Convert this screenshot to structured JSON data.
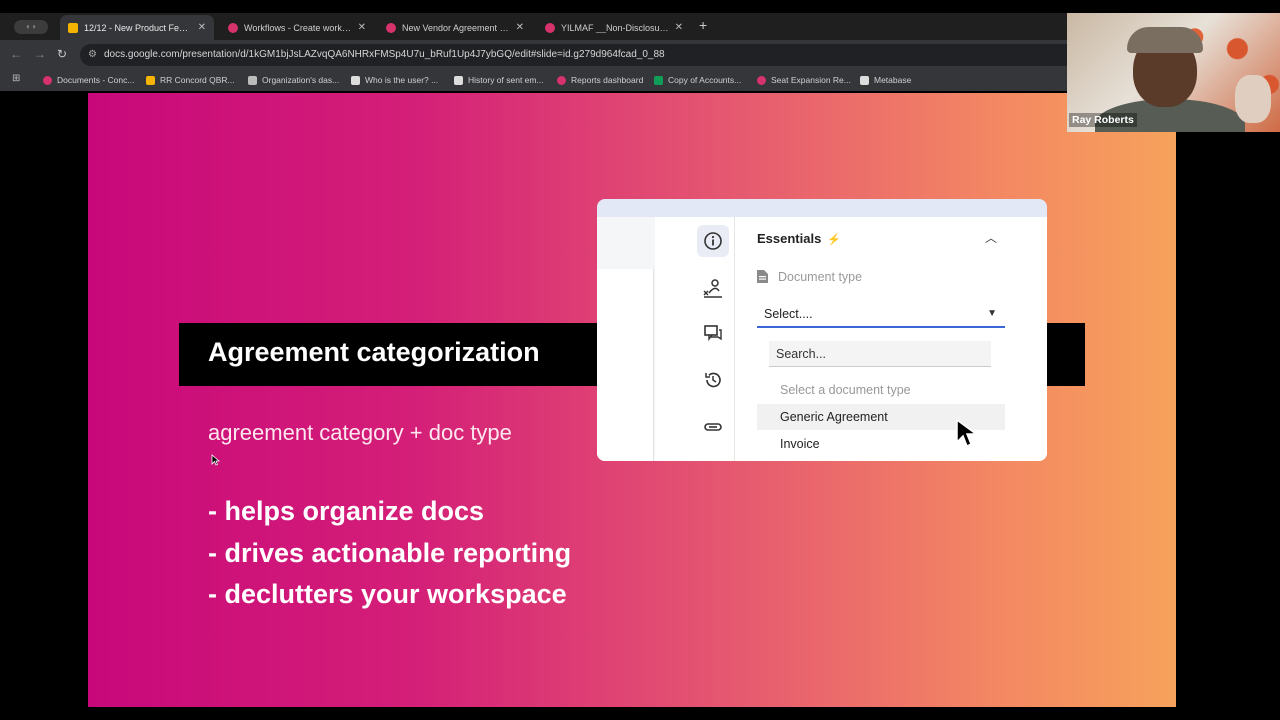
{
  "browser": {
    "tabs": [
      {
        "title": "12/12 - New Product Features",
        "favicon_color": "#f4b400",
        "active": true
      },
      {
        "title": "Workflows - Create workflow",
        "favicon_color": "#d6336c",
        "active": false
      },
      {
        "title": "New Vendor Agreement - Pr...",
        "favicon_color": "#d6336c",
        "active": false
      },
      {
        "title": "YILMAF __Non-Disclosure Ag...",
        "favicon_color": "#d6336c",
        "active": false
      }
    ],
    "new_tab_label": "+",
    "url": "docs.google.com/presentation/d/1kGM1bjJsLAZvqQA6NHRxFMSp4U7u_bRuf1Up4J7ybGQ/edit#slide=id.g279d964fcad_0_88",
    "bookmarks": [
      {
        "label": "Documents - Conc...",
        "color": "#d6336c"
      },
      {
        "label": "RR Concord QBR...",
        "color": "#f4b400"
      },
      {
        "label": "Organization's das...",
        "color": "#bbbbbb"
      },
      {
        "label": "Who is the user? ...",
        "color": "#dddddd"
      },
      {
        "label": "History of sent em...",
        "color": "#dddddd"
      },
      {
        "label": "Reports dashboard",
        "color": "#d6336c"
      },
      {
        "label": "Copy of Accounts...",
        "color": "#0f9d58"
      },
      {
        "label": "Seat Expansion Re...",
        "color": "#d6336c"
      },
      {
        "label": "Metabase",
        "color": "#dddddd"
      }
    ]
  },
  "slide": {
    "title": "Agreement categorization",
    "subtitle": "agreement category + doc type",
    "bullets": [
      "- helps organize docs",
      "- drives actionable reporting",
      "- declutters your workspace"
    ],
    "panel": {
      "section_title": "Essentials",
      "field_label": "Document type",
      "select_value": "Select....",
      "search_placeholder": "Search...",
      "options": [
        "Select a document type",
        "Generic Agreement",
        "Invoice"
      ]
    }
  },
  "webcam": {
    "participant_name": "Ray Roberts"
  },
  "icons": {
    "info": "info-icon",
    "signature": "signature-icon",
    "comments": "comments-icon",
    "history": "history-icon",
    "attachment": "attachment-icon",
    "bolt": "bolt-icon",
    "chevron_up": "chevron-up-icon",
    "document": "document-icon",
    "caret_down": "caret-down-icon"
  }
}
